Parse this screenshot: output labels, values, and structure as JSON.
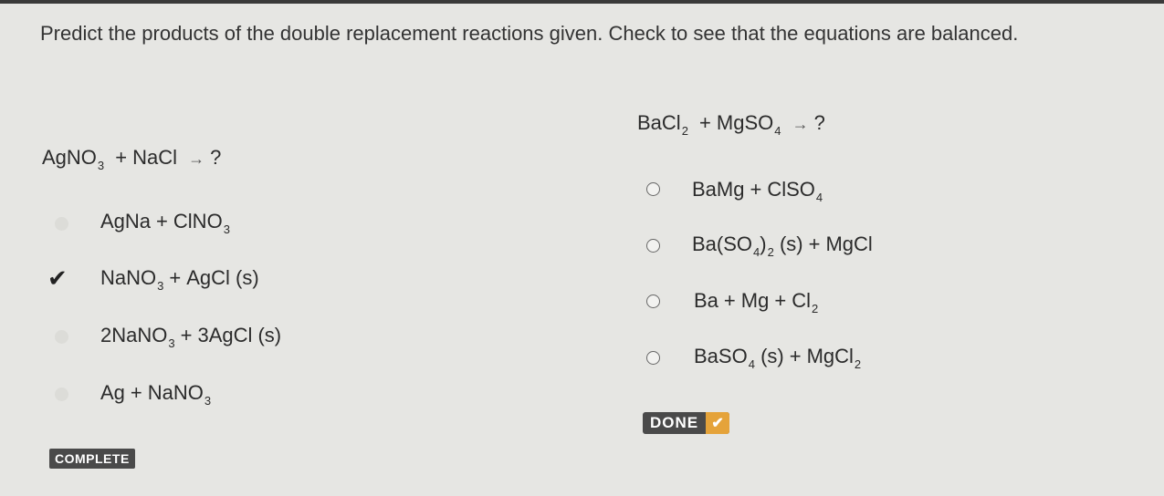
{
  "instructions": "Predict the products of the double replacement reactions given. Check to see that the equations are balanced.",
  "left_question": {
    "prompt": {
      "a": "AgNO",
      "a_sub": "3",
      "plus": "+",
      "b": "NaCl",
      "arrow": "→",
      "q": "?"
    },
    "options": [
      {
        "parts": [
          "AgNa",
          "+",
          "ClNO"
        ],
        "sub": "3",
        "selected": false
      },
      {
        "parts": [
          "NaNO",
          "3",
          "+",
          "AgCl (s)"
        ],
        "selected": true
      },
      {
        "parts": [
          "2NaNO",
          "3",
          "+",
          "3AgCl (s)"
        ],
        "selected": false
      },
      {
        "parts": [
          "Ag",
          "+",
          "NaNO",
          "3"
        ],
        "selected": false
      }
    ],
    "status_badge": "COMPLETE"
  },
  "right_question": {
    "prompt": {
      "a": "BaCl",
      "a_sub": "2",
      "plus": "+",
      "b": "MgSO",
      "b_sub": "4",
      "arrow": "→",
      "q": "?"
    },
    "options": [
      {
        "a": "BaMg",
        "plus": "+",
        "b": "ClSO",
        "b_sub": "4"
      },
      {
        "a": "Ba(SO",
        "a_sub": "4",
        "a_close": ")",
        "a_sub2": "2",
        "a_state": "(s)",
        "plus": "+",
        "b": "MgCl"
      },
      {
        "a": "Ba",
        "plus1": "+",
        "b": "Mg",
        "plus2": "+",
        "c": "Cl",
        "c_sub": "2"
      },
      {
        "a": "BaSO",
        "a_sub": "4",
        "a_state": "(s)",
        "plus": "+",
        "b": "MgCl",
        "b_sub": "2"
      }
    ],
    "done_label": "DONE",
    "done_check": "✔"
  },
  "colors": {
    "background": "#e6e6e3",
    "badge": "#4a4a4a",
    "done_accent": "#e5a33a"
  }
}
